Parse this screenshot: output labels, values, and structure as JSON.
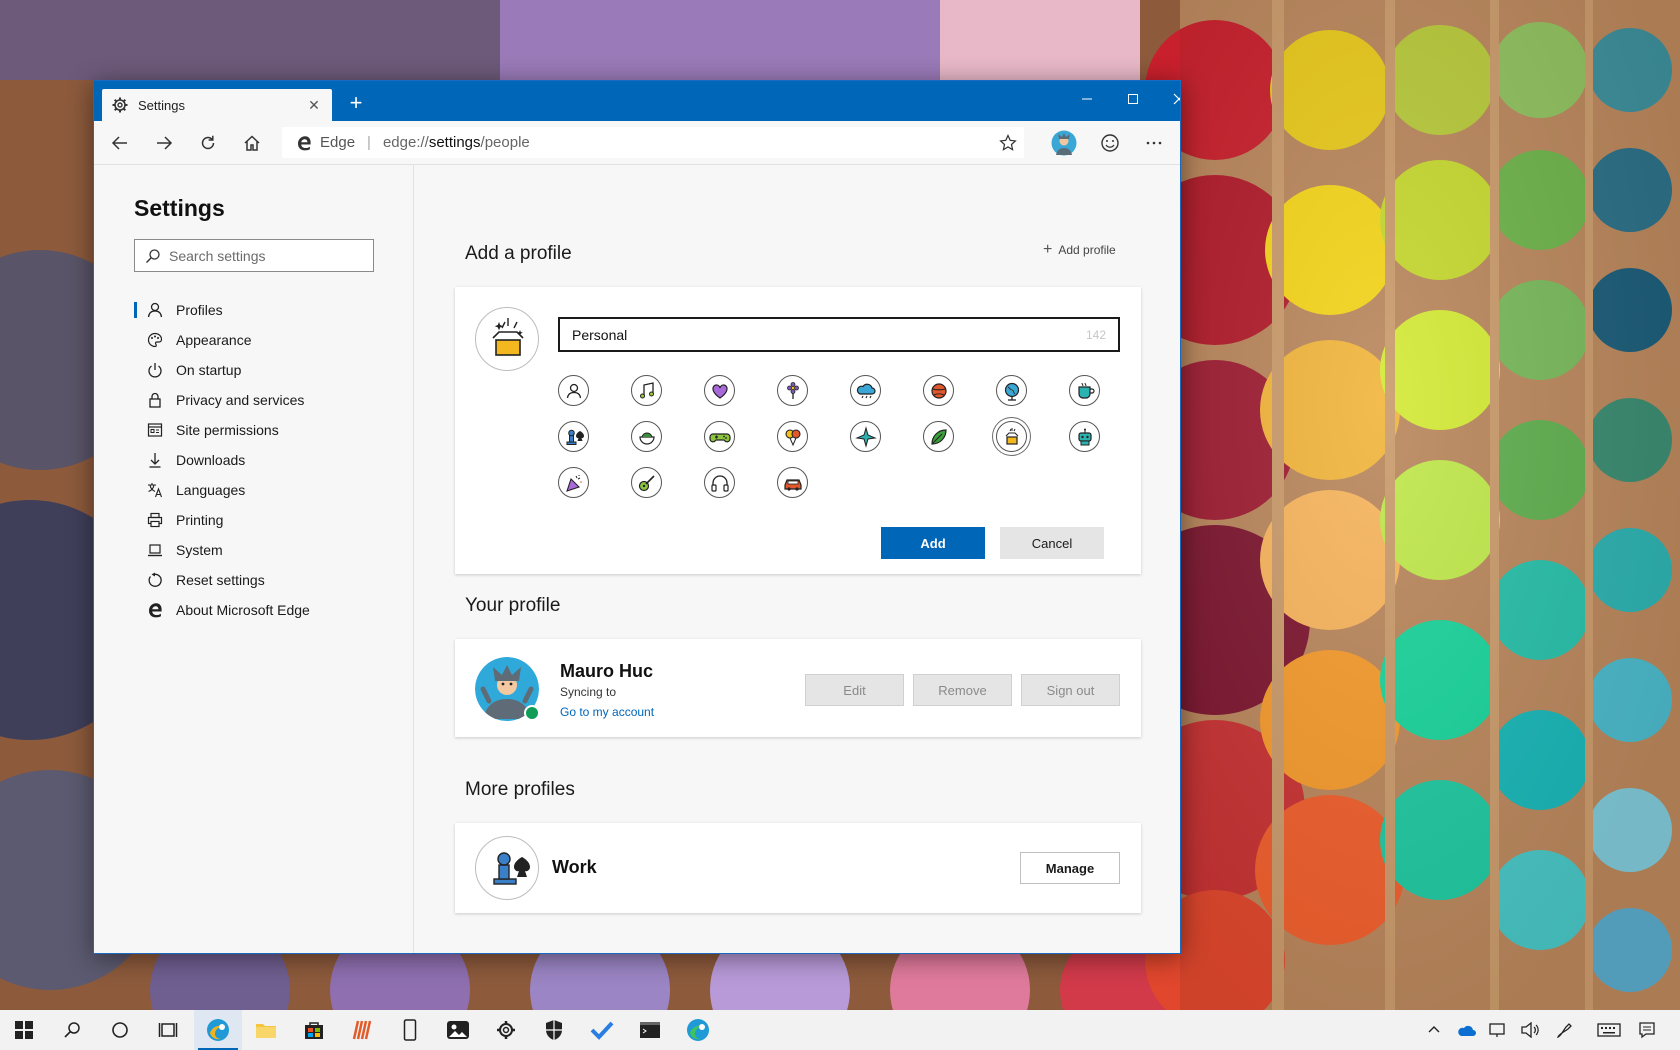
{
  "browser": {
    "tab_title": "Settings",
    "address": {
      "site_label": "Edge",
      "url_prefix": "edge://",
      "url_host": "settings",
      "url_path": "/people"
    }
  },
  "sidebar": {
    "title": "Settings",
    "search_placeholder": "Search settings",
    "items": [
      {
        "label": "Profiles",
        "icon": "person-icon",
        "active": true
      },
      {
        "label": "Appearance",
        "icon": "palette-icon"
      },
      {
        "label": "On startup",
        "icon": "power-icon"
      },
      {
        "label": "Privacy and services",
        "icon": "lock-icon"
      },
      {
        "label": "Site permissions",
        "icon": "site-permissions-icon"
      },
      {
        "label": "Downloads",
        "icon": "download-icon"
      },
      {
        "label": "Languages",
        "icon": "languages-icon"
      },
      {
        "label": "Printing",
        "icon": "printer-icon"
      },
      {
        "label": "System",
        "icon": "laptop-icon"
      },
      {
        "label": "Reset settings",
        "icon": "reset-icon"
      },
      {
        "label": "About Microsoft Edge",
        "icon": "edge-logo-icon"
      }
    ]
  },
  "add_profile": {
    "section_title": "Add a profile",
    "add_profile_link": "Add profile",
    "name_value": "Personal",
    "char_count": "142",
    "avatar_options": [
      "person-icon",
      "music-note-icon",
      "heart-icon",
      "flower-icon",
      "cloud-icon",
      "ball-icon",
      "globe-icon",
      "coffee-cup-icon",
      "chess-icon",
      "bowl-icon",
      "gamepad-icon",
      "balloons-icon",
      "airplane-icon",
      "leaf-icon",
      "gift-box-icon",
      "robot-icon",
      "party-icon",
      "guitar-icon",
      "headphones-icon",
      "car-icon"
    ],
    "selected_avatar": "gift-box-icon",
    "add_label": "Add",
    "cancel_label": "Cancel"
  },
  "your_profile": {
    "section_title": "Your profile",
    "name": "Mauro Huc",
    "status": "Syncing to",
    "account_link": "Go to my account",
    "edit_label": "Edit",
    "remove_label": "Remove",
    "signout_label": "Sign out"
  },
  "more_profiles": {
    "section_title": "More profiles",
    "profiles": [
      {
        "name": "Work",
        "icon": "chess-icon",
        "manage_label": "Manage"
      }
    ]
  },
  "colors": {
    "accent": "#0066b8",
    "titlebar": "#0066b8"
  }
}
